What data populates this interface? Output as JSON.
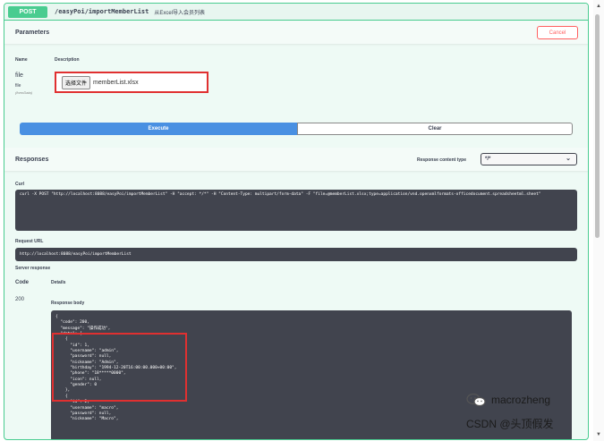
{
  "operation": {
    "method": "POST",
    "path": "/easyPoi/importMemberList",
    "summary": "从Excel导入会员列表"
  },
  "parameters": {
    "title": "Parameters",
    "cancel_label": "Cancel",
    "col_name": "Name",
    "col_description": "Description",
    "param": {
      "name": "file",
      "type": "file",
      "location": "(formData)",
      "choose_label": "选择文件",
      "file_name": "memberList.xlsx"
    },
    "execute_label": "Execute",
    "clear_label": "Clear"
  },
  "responses": {
    "title": "Responses",
    "content_type_label": "Response content type",
    "content_type_value": "*/*",
    "curl_label": "Curl",
    "curl_text": "curl -X POST \"http://localhost:8088/easyPoi/importMemberList\" -H \"accept: */*\" -H \"Content-Type: multipart/form-data\" -F \"file=@memberList.xlsx;type=application/vnd.openxmlformats-officedocument.spreadsheetml.sheet\"",
    "request_url_label": "Request URL",
    "request_url": "http://localhost:8088/easyPoi/importMemberList",
    "server_response_label": "Server response",
    "code_label": "Code",
    "details_label": "Details",
    "status_code": "200",
    "body_label": "Response body",
    "body_lines": [
      "{",
      "  \"code\": 200,",
      "  \"message\": \"操作成功\",",
      "  \"data\": [",
      "    {",
      "      \"id\": 1,",
      "      \"username\": \"admin\",",
      "      \"password\": null,",
      "      \"nickname\": \"Admin\",",
      "      \"birthday\": \"1994-12-20T16:00:00.000+00:00\",",
      "      \"phone\": \"18*****0000\",",
      "      \"icon\": null,",
      "      \"gender\": 0",
      "    },",
      "    {",
      "      \"id\": 2,",
      "      \"username\": \"macro\",",
      "      \"password\": null,",
      "      \"nickname\": \"Macro\","
    ]
  },
  "watermark": {
    "name": "macrozheng",
    "csdn": "CSDN @头顶假发"
  }
}
